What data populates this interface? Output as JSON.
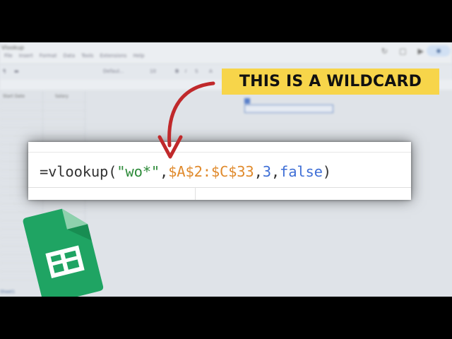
{
  "background": {
    "doc_title": "Vlookup",
    "menu": [
      "File",
      "Insert",
      "Format",
      "Data",
      "Tools",
      "Extensions",
      "Help"
    ],
    "toolbar_font": "Defaul...",
    "toolbar_size": "10",
    "column_headers": [
      "Start Date",
      "Salary"
    ],
    "sheet_tab": "Sheet1"
  },
  "callout": {
    "text": "THIS IS A WILDCARD"
  },
  "formula": {
    "segments": [
      {
        "type": "plain",
        "text": "=vlookup("
      },
      {
        "type": "string",
        "text": "\"wo*\""
      },
      {
        "type": "plain",
        "text": ","
      },
      {
        "type": "range",
        "text": "$A$2:$C$33"
      },
      {
        "type": "plain",
        "text": ","
      },
      {
        "type": "number",
        "text": "3"
      },
      {
        "type": "plain",
        "text": ","
      },
      {
        "type": "boolean",
        "text": "false"
      },
      {
        "type": "plain",
        "text": ")"
      }
    ]
  },
  "colors": {
    "callout_bg": "#f7d54a",
    "arrow": "#c0292b",
    "string": "#2e8b3a",
    "range": "#e08a2c",
    "number": "#3f6fd6",
    "sheets_green": "#1fa463"
  },
  "icons": {
    "logo": "google-sheets-icon",
    "arrow": "curved-arrow-icon"
  }
}
